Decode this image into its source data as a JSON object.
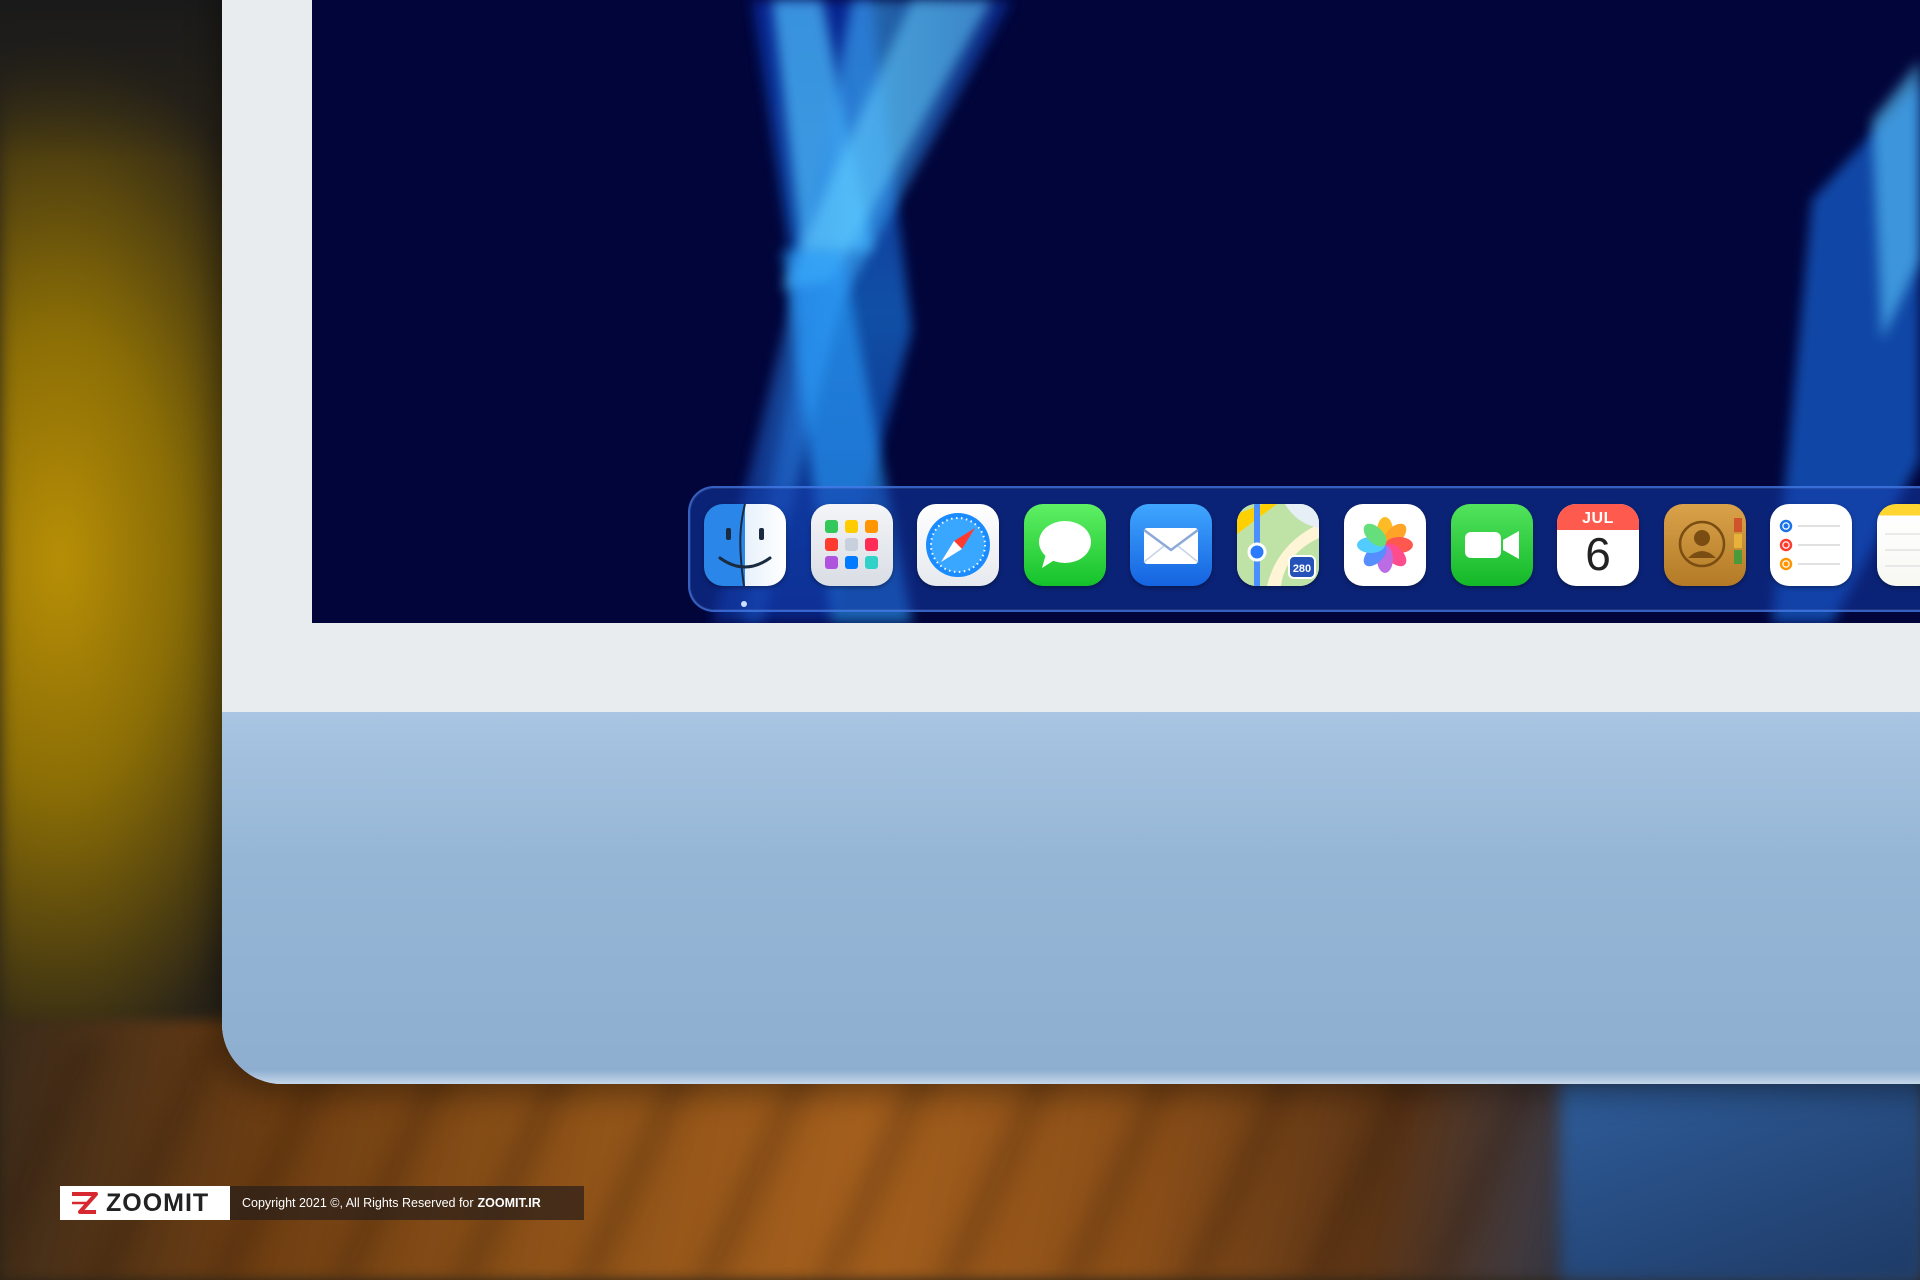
{
  "dock": {
    "apps": [
      {
        "id": "finder",
        "icon": "finder-icon",
        "running": true
      },
      {
        "id": "launchpad",
        "icon": "launchpad-icon"
      },
      {
        "id": "safari",
        "icon": "safari-icon"
      },
      {
        "id": "messages",
        "icon": "messages-icon"
      },
      {
        "id": "mail",
        "icon": "mail-icon"
      },
      {
        "id": "maps",
        "icon": "maps-icon",
        "badge_text": "280"
      },
      {
        "id": "photos",
        "icon": "photos-icon"
      },
      {
        "id": "facetime",
        "icon": "facetime-icon"
      },
      {
        "id": "calendar",
        "icon": "calendar-icon",
        "month": "JUL",
        "day": "6"
      },
      {
        "id": "contacts",
        "icon": "contacts-icon"
      },
      {
        "id": "reminders",
        "icon": "reminders-icon"
      },
      {
        "id": "notes",
        "icon": "notes-icon"
      }
    ]
  },
  "watermark": {
    "logo_text": "ZOOMIT",
    "copyright": "Copyright 2021 ©, All Rights Reserved for",
    "site": "ZOOMIT.IR"
  },
  "colors": {
    "wallpaper": "#02053a",
    "wallpaper_glow": "#1e8bff",
    "imac_chin": "#96b6d6",
    "imac_bezel": "#e9ecef",
    "watermark_red": "#d7282f"
  }
}
